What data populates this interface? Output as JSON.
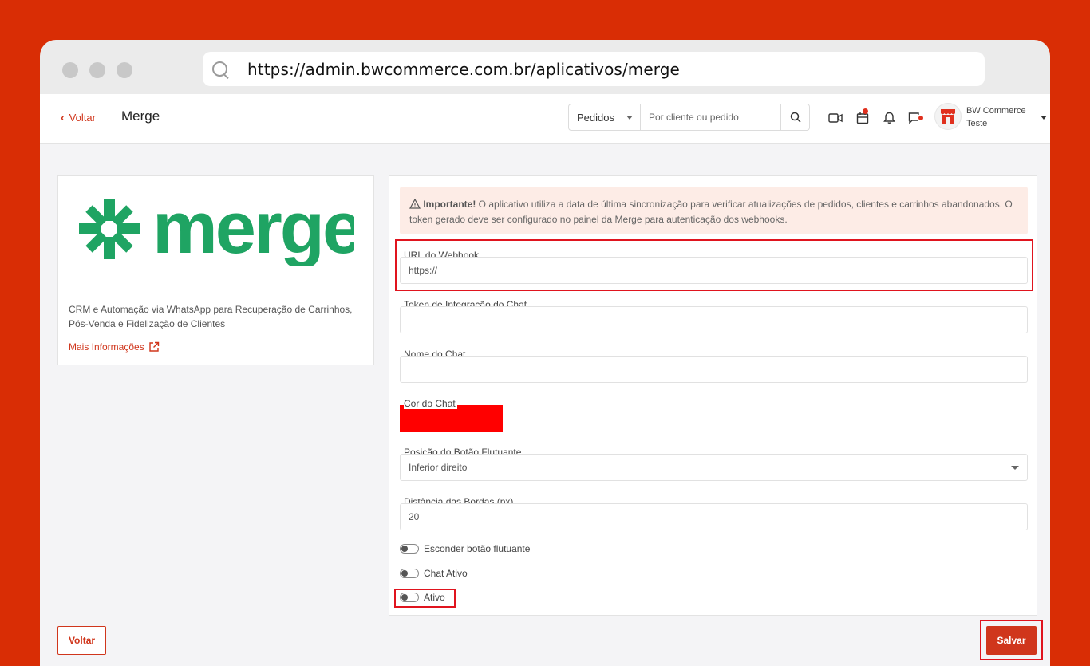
{
  "browser": {
    "url": "https://admin.bwcommerce.com.br/aplicativos/merge"
  },
  "header": {
    "back_label": "Voltar",
    "title": "Merge",
    "search_scope": "Pedidos",
    "search_placeholder": "Por cliente ou pedido",
    "user_name_line1": "BW Commerce",
    "user_name_line2": "Teste",
    "icons": [
      "video-icon",
      "calendar-icon",
      "bell-icon",
      "chat-icon",
      "store-icon"
    ]
  },
  "app": {
    "logo_text": "merge",
    "description": "CRM e Automação via WhatsApp para Recuperação de Carrinhos, Pós-Venda e Fidelização de Clientes",
    "more_info_label": "Mais Informações"
  },
  "alert": {
    "strong": "Importante!",
    "text": " O aplicativo utiliza a data de última sincronização para verificar atualizações de pedidos, clientes e carrinhos abandonados. O token gerado deve ser configurado no painel da Merge para autenticação dos webhooks."
  },
  "form": {
    "webhook_label": "URL do Webhook",
    "webhook_value": "https://",
    "token_label": "Token de Integração do Chat",
    "token_value": "",
    "chat_name_label": "Nome do Chat",
    "chat_name_value": "",
    "chat_color_label": "Cor do Chat",
    "chat_color_value": "#ff0000",
    "position_label": "Posição do Botão Flutuante",
    "position_value": "Inferior direito",
    "distance_label": "Distância das Bordas (px)",
    "distance_value": "20",
    "toggles": [
      {
        "label": "Esconder botão flutuante",
        "on": false
      },
      {
        "label": "Chat Ativo",
        "on": false
      },
      {
        "label": "Ativo",
        "on": false
      }
    ]
  },
  "footer": {
    "back_label": "Voltar",
    "save_label": "Salvar"
  },
  "colors": {
    "brand": "#d0361c",
    "background": "#d92d05",
    "highlight": "#e0141e",
    "merge_green": "#1fa463"
  }
}
